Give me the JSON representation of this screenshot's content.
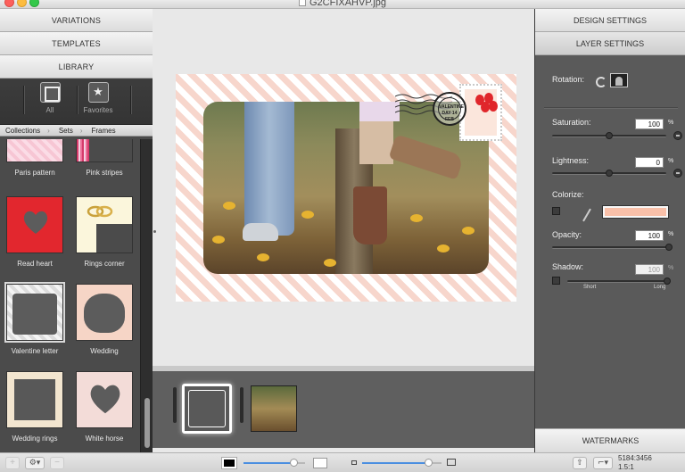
{
  "window": {
    "title": "G2CFIXAHVP.jpg"
  },
  "left_panel": {
    "variations_label": "VARIATIONS",
    "templates_label": "TEMPLATES",
    "library_label": "LIBRARY",
    "library_items": [
      {
        "label": "All",
        "icon": "square-frame-icon"
      },
      {
        "label": "Favorites",
        "icon": "star-icon"
      }
    ],
    "breadcrumbs": [
      "Collections",
      "Sets",
      "Frames"
    ],
    "frames": [
      {
        "caption": "Paris pattern"
      },
      {
        "caption": "Pink stripes"
      },
      {
        "caption": "Read heart"
      },
      {
        "caption": "Rings corner"
      },
      {
        "caption": "Valentine letter"
      },
      {
        "caption": "Wedding"
      },
      {
        "caption": "Wedding rings"
      },
      {
        "caption": "White horse"
      }
    ]
  },
  "canvas": {
    "stamp_text": "VALENTINE DAY 14 FEB"
  },
  "right_panel": {
    "design_settings_label": "DESIGN SETTINGS",
    "layer_settings_label": "LAYER SETTINGS",
    "rotation_label": "Rotation:",
    "saturation": {
      "label": "Saturation:",
      "value": "100",
      "unit": "%",
      "level": 0.5
    },
    "lightness": {
      "label": "Lightness:",
      "value": "0",
      "unit": "%",
      "level": 0.5
    },
    "colorize": {
      "label": "Colorize:",
      "color": "#f9c0a9"
    },
    "opacity": {
      "label": "Opacity:",
      "value": "100",
      "unit": "%",
      "level": 1.0
    },
    "shadow": {
      "label": "Shadow:",
      "value": "100",
      "unit": "%",
      "min_label": "Short",
      "max_label": "Long",
      "level": 1.0
    },
    "watermarks_label": "WATERMARKS"
  },
  "bottom_bar": {
    "add_icon": "+",
    "settings_icon": "gear-icon",
    "remove_icon": "−",
    "border_color_slider": 0.83,
    "size_slider": 0.83,
    "dimensions": "5184:3456",
    "ratio": "1.5:1"
  }
}
